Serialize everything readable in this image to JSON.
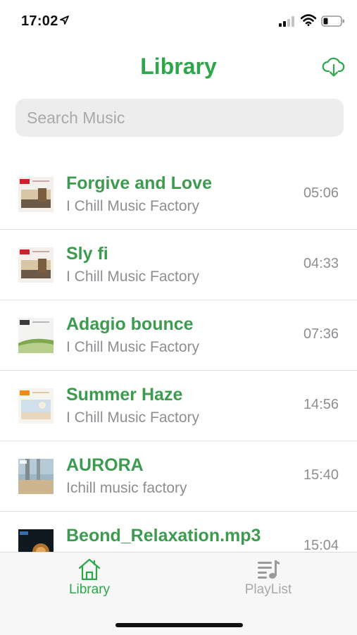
{
  "status_bar": {
    "time": "17:02"
  },
  "header": {
    "title": "Library"
  },
  "search": {
    "placeholder": "Search Music",
    "value": ""
  },
  "songs": [
    {
      "title": "Forgive and Love",
      "artist": "I Chill Music Factory",
      "duration": "05:06",
      "art": "red-label"
    },
    {
      "title": "Sly fi",
      "artist": "I Chill Music Factory",
      "duration": "04:33",
      "art": "red-label"
    },
    {
      "title": "Adagio bounce",
      "artist": "I Chill Music Factory",
      "duration": "07:36",
      "art": "dark-label"
    },
    {
      "title": "Summer Haze",
      "artist": "I Chill Music Factory",
      "duration": "14:56",
      "art": "orange-label"
    },
    {
      "title": "AURORA",
      "artist": "Ichill music factory",
      "duration": "15:40",
      "art": "beach-photo"
    },
    {
      "title": "Beond_Relaxation.mp3",
      "artist": "",
      "duration": "15:04",
      "art": "dark-cover"
    }
  ],
  "tabs": [
    {
      "label": "Library",
      "icon": "home-icon",
      "active": true
    },
    {
      "label": "PlayList",
      "icon": "playlist-icon",
      "active": false
    }
  ],
  "colors": {
    "accent": "#2ea64b",
    "title_green": "#3d9b50",
    "secondary": "#8e8e93"
  }
}
